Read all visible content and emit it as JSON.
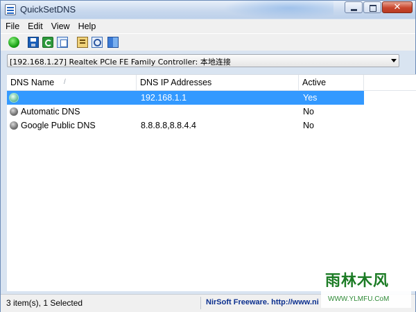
{
  "window": {
    "title": "QuickSetDNS"
  },
  "menu": {
    "items": [
      "File",
      "Edit",
      "View",
      "Help"
    ]
  },
  "toolbar": {
    "icons": [
      "start-icon",
      "save-icon",
      "refresh-icon",
      "copy-icon",
      "properties-icon",
      "find-icon",
      "exit-icon"
    ]
  },
  "adapter_select": {
    "value": "[192.168.1.27]  Realtek PCIe FE Family Controller: 本地连接"
  },
  "list": {
    "columns": [
      "DNS Name",
      "DNS IP Addresses",
      "Active"
    ],
    "sort_glyph": "/",
    "rows": [
      {
        "name": "",
        "ip": "192.168.1.1",
        "active": "Yes",
        "selected": true
      },
      {
        "name": "Automatic DNS",
        "ip": "",
        "active": "No",
        "selected": false
      },
      {
        "name": "Google Public DNS",
        "ip": "8.8.8.8,8.8.4.4",
        "active": "No",
        "selected": false
      }
    ]
  },
  "status": {
    "items_text": "3 item(s), 1 Selected",
    "link_text": "NirSoft Freeware.  http://www.ni"
  },
  "watermark": {
    "logo_text": "雨林木风",
    "url_text": "WWW.YLMFU.CoM"
  },
  "colors": {
    "selection": "#3399ff",
    "link": "#0b2f8e",
    "title_bar": "#c9d9ee"
  }
}
